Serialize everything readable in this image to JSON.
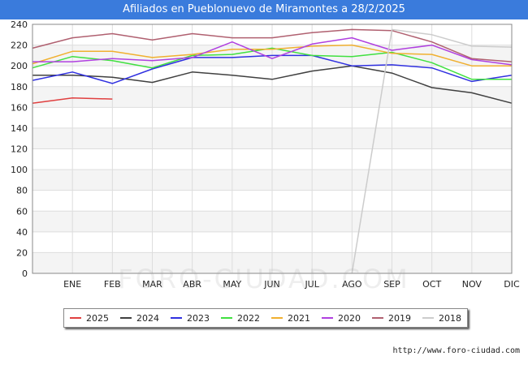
{
  "header": {
    "title": "Afiliados en Pueblonuevo de Miramontes a 28/2/2025"
  },
  "watermark": "FORO-CIUDAD.COM",
  "source": "http://www.foro-ciudad.com",
  "chart_data": {
    "type": "line",
    "categories": [
      "ENE",
      "FEB",
      "MAR",
      "ABR",
      "MAY",
      "JUN",
      "JUL",
      "AGO",
      "SEP",
      "OCT",
      "NOV",
      "DIC"
    ],
    "x_index_range": [
      -1,
      11
    ],
    "ylim": [
      0,
      240
    ],
    "yticks": [
      0,
      20,
      40,
      60,
      80,
      100,
      120,
      140,
      160,
      180,
      200,
      220,
      240
    ],
    "grid": true,
    "legend_position": "bottom",
    "series": [
      {
        "name": "2025",
        "color": "#e04040",
        "points": [
          [
            -1,
            164
          ],
          [
            0,
            169
          ],
          [
            1,
            168
          ]
        ]
      },
      {
        "name": "2024",
        "color": "#404040",
        "points": [
          [
            -1,
            191
          ],
          [
            0,
            191
          ],
          [
            1,
            189
          ],
          [
            2,
            184
          ],
          [
            3,
            194
          ],
          [
            4,
            191
          ],
          [
            5,
            187
          ],
          [
            6,
            195
          ],
          [
            7,
            200
          ],
          [
            8,
            193
          ],
          [
            9,
            179
          ],
          [
            10,
            174
          ],
          [
            11,
            164
          ]
        ]
      },
      {
        "name": "2023",
        "color": "#3030e0",
        "points": [
          [
            -1,
            186
          ],
          [
            0,
            194
          ],
          [
            1,
            183
          ],
          [
            2,
            197
          ],
          [
            3,
            208
          ],
          [
            4,
            208
          ],
          [
            5,
            210
          ],
          [
            6,
            210
          ],
          [
            7,
            200
          ],
          [
            8,
            201
          ],
          [
            9,
            198
          ],
          [
            10,
            185
          ],
          [
            11,
            191
          ]
        ]
      },
      {
        "name": "2022",
        "color": "#40e040",
        "points": [
          [
            -1,
            198
          ],
          [
            0,
            209
          ],
          [
            1,
            205
          ],
          [
            2,
            198
          ],
          [
            3,
            210
          ],
          [
            4,
            211
          ],
          [
            5,
            217
          ],
          [
            6,
            210
          ],
          [
            7,
            209
          ],
          [
            8,
            213
          ],
          [
            9,
            203
          ],
          [
            10,
            187
          ],
          [
            11,
            187
          ]
        ]
      },
      {
        "name": "2021",
        "color": "#f0b030",
        "points": [
          [
            -1,
            202
          ],
          [
            0,
            214
          ],
          [
            1,
            214
          ],
          [
            2,
            208
          ],
          [
            3,
            211
          ],
          [
            4,
            216
          ],
          [
            5,
            216
          ],
          [
            6,
            219
          ],
          [
            7,
            220
          ],
          [
            8,
            212
          ],
          [
            9,
            211
          ],
          [
            10,
            200
          ],
          [
            11,
            200
          ]
        ]
      },
      {
        "name": "2020",
        "color": "#b040e0",
        "points": [
          [
            -1,
            204
          ],
          [
            0,
            204
          ],
          [
            1,
            207
          ],
          [
            2,
            205
          ],
          [
            3,
            208
          ],
          [
            4,
            223
          ],
          [
            5,
            207
          ],
          [
            6,
            221
          ],
          [
            7,
            227
          ],
          [
            8,
            215
          ],
          [
            9,
            220
          ],
          [
            10,
            206
          ],
          [
            11,
            201
          ]
        ]
      },
      {
        "name": "2019",
        "color": "#b06070",
        "points": [
          [
            -1,
            217
          ],
          [
            0,
            227
          ],
          [
            1,
            231
          ],
          [
            2,
            225
          ],
          [
            3,
            231
          ],
          [
            4,
            227
          ],
          [
            5,
            227
          ],
          [
            6,
            232
          ],
          [
            7,
            235
          ],
          [
            8,
            234
          ],
          [
            9,
            223
          ],
          [
            10,
            207
          ],
          [
            11,
            204
          ]
        ]
      },
      {
        "name": "2018",
        "color": "#cccccc",
        "points": [
          [
            7,
            0
          ],
          [
            8,
            235
          ],
          [
            9,
            230
          ],
          [
            10,
            219
          ],
          [
            11,
            218
          ]
        ]
      }
    ]
  }
}
